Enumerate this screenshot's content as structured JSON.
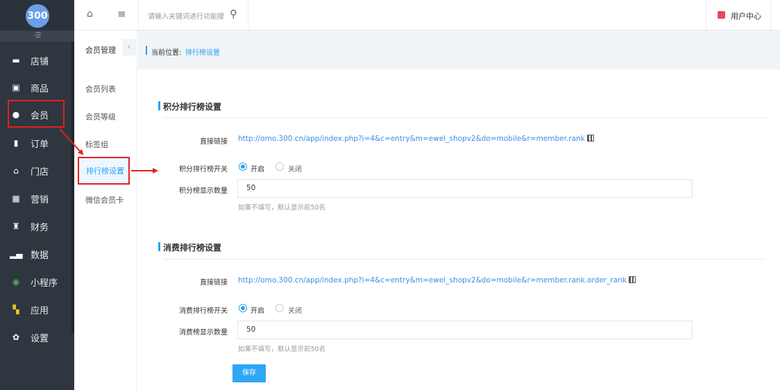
{
  "app": {
    "logo_text": "300",
    "fold_icon": "·☰"
  },
  "sidebar": {
    "items": [
      {
        "label": "店铺",
        "icon": "store-icon"
      },
      {
        "label": "商品",
        "icon": "goods-icon"
      },
      {
        "label": "会员",
        "icon": "user-icon"
      },
      {
        "label": "订单",
        "icon": "order-icon"
      },
      {
        "label": "门店",
        "icon": "shop-icon"
      },
      {
        "label": "营销",
        "icon": "gift-icon"
      },
      {
        "label": "财务",
        "icon": "money-bag-icon"
      },
      {
        "label": "数据",
        "icon": "chart-icon"
      },
      {
        "label": "小程序",
        "icon": "miniprogram-icon"
      },
      {
        "label": "应用",
        "icon": "apps-icon"
      },
      {
        "label": "设置",
        "icon": "gear-icon"
      }
    ]
  },
  "submenu": {
    "title": "会员管理",
    "collapse_icon": "‹",
    "items": [
      "会员列表",
      "会员等级",
      "标签组",
      "排行榜设置",
      "微信会员卡"
    ],
    "active": "排行榜设置"
  },
  "topbar": {
    "search_placeholder": "请输入关键词进行功能搜",
    "user_center": "用户中心"
  },
  "breadcrumb": {
    "label": "当前位置:",
    "current": "排行榜设置"
  },
  "points_section": {
    "title": "积分排行榜设置",
    "link_label": "直接链接",
    "link": "http://omo.300.cn/app/index.php?i=4&c=entry&m=ewel_shopv2&do=mobile&r=member.rank",
    "switch_label": "积分排行榜开关",
    "on_label": "开启",
    "off_label": "关闭",
    "switch_value": "开启",
    "count_label": "积分榜显示数量",
    "count_value": "50",
    "hint": "如果不填写，默认显示前50名"
  },
  "spend_section": {
    "title": "消费排行榜设置",
    "link_label": "直接链接",
    "link": "http://omo.300.cn/app/index.php?i=4&c=entry&m=ewel_shopv2&do=mobile&r=member.rank.order_rank",
    "switch_label": "消费排行榜开关",
    "on_label": "开启",
    "off_label": "关闭",
    "switch_value": "开启",
    "count_label": "消费榜显示数量",
    "count_value": "50",
    "hint": "如果不填写，默认显示前50名"
  },
  "save_label": "保存",
  "colors": {
    "sidebar_bg": "#2f3640",
    "accent": "#29a3f2",
    "link": "#3a8ee6",
    "annotation": "#e02020"
  }
}
